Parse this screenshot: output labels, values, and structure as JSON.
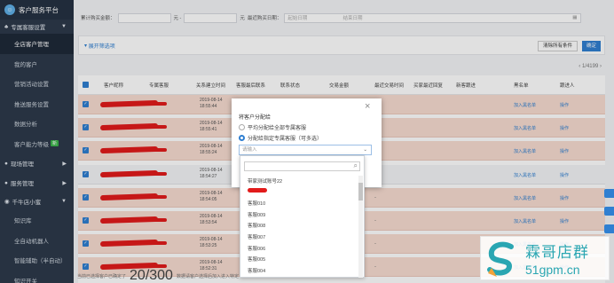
{
  "sidebar": {
    "title": "客户服务平台",
    "group_main": "专属客服设置",
    "items": [
      {
        "label": "全店客户管理",
        "active": true
      },
      {
        "label": "我的客户"
      },
      {
        "label": "营销活动设置"
      },
      {
        "label": "推送服务设置"
      },
      {
        "label": "数据分析"
      },
      {
        "label": "客户能力等级",
        "badge": "新"
      }
    ],
    "groups": [
      "现场管理",
      "服务管理",
      "千牛店小蜜"
    ],
    "sub_items": [
      "知识库",
      "全自动机器人",
      "智能辅助（半自动）",
      "知识开关"
    ]
  },
  "filter": {
    "label1": "累计购买金额：",
    "yuan1": "元 -",
    "yuan2": "元",
    "label2": "最近购买日期：",
    "start_placeholder": "起始日期",
    "end_placeholder": "结束日期"
  },
  "card": {
    "expand_label": "展开筛选项",
    "clear_btn": "清除所有条件",
    "confirm_btn": "确定"
  },
  "pager": {
    "text": "1/4199"
  },
  "table": {
    "headers": [
      "客户昵称",
      "专属客服",
      "关系建立时间",
      "客服最后联系",
      "联系状态",
      "交易金额",
      "最近交易时间",
      "买家最近回复",
      "新客跟进",
      "黑名单",
      "跟进人"
    ],
    "rows": [
      {
        "date": "2019-08-14",
        "time": "18:55:44",
        "value": "-",
        "blacklist": "加入黑名单",
        "op": "操作",
        "alt": false
      },
      {
        "date": "2019-08-14",
        "time": "18:55:41",
        "value": "-",
        "blacklist": "加入黑名单",
        "op": "操作",
        "alt": false
      },
      {
        "date": "2019-08-14",
        "time": "18:55:24",
        "value": "-",
        "blacklist": "加入黑名单",
        "op": "操作",
        "alt": false
      },
      {
        "date": "2019-08-14",
        "time": "18:54:27",
        "value": "-",
        "blacklist": "加入黑名单",
        "op": "操作",
        "alt": true
      },
      {
        "date": "2019-08-14",
        "time": "18:54:05",
        "value": "-",
        "blacklist": "加入黑名单",
        "op": "操作",
        "alt": false
      },
      {
        "date": "2019-08-14",
        "time": "18:53:54",
        "value": "-",
        "blacklist": "加入黑名单",
        "op": "操作",
        "alt": false
      },
      {
        "date": "2019-08-14",
        "time": "18:53:25",
        "value": "-",
        "blacklist": "加入黑名单",
        "op": "操作",
        "alt": false
      },
      {
        "date": "2019-08-14",
        "time": "18:52:31",
        "value": "-",
        "blacklist": "加入黑名单",
        "op": "操作",
        "alt": false
      }
    ]
  },
  "footer": {
    "left": "当前已选择客户已确定了",
    "count": "20/300",
    "right": "数据请客户选择后加入进入特定"
  },
  "dialog": {
    "title": "将客户分配给",
    "option1": "平均分配给全部专属客服",
    "option2": "分配给指定专属客服（可多选）",
    "select_placeholder": "请输入"
  },
  "dropdown": {
    "options": [
      "带家测试账号22",
      "",
      "客服010",
      "客服009",
      "客服008",
      "客服007",
      "客服006",
      "客服005",
      "客服004"
    ]
  },
  "watermark": {
    "brand": "霖哥店群",
    "url": "51gpm.cn"
  },
  "colors": {
    "sidebar": "#2d3a4b",
    "accent": "#2f7fd1",
    "highlight_row": "#f7dcd1",
    "watermark": "#2aa6b2"
  }
}
